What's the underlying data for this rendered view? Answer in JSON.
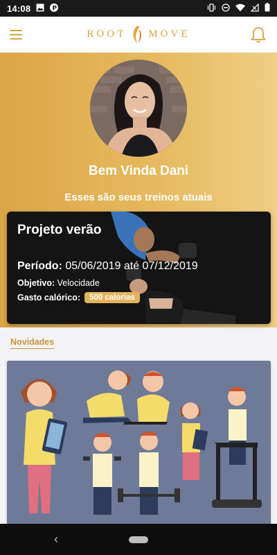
{
  "status_bar": {
    "time": "14:08",
    "left_icons": [
      "image-icon",
      "p-icon"
    ],
    "right_icons": [
      "vibrate-icon",
      "dnd-icon",
      "wifi-icon",
      "no-signal-icon",
      "battery-icon"
    ]
  },
  "app_bar": {
    "brand_left": "ROOT",
    "brand_right": "MOVE",
    "brand_icon": "leaf-icon",
    "menu_icon": "hamburger-icon",
    "notification_icon": "bell-icon",
    "accent_color": "#d9a341"
  },
  "hero": {
    "welcome": "Bem Vinda Dani",
    "subtitle": "Esses são seus treinos atuais",
    "gradient": [
      "#dba646",
      "#efcf84"
    ]
  },
  "workout": {
    "title": "Projeto verão",
    "period_label": "Período:",
    "period_value": "05/06/2019 até 07/12/2019",
    "goal_label": "Objetivo:",
    "goal_value": "Velocidade",
    "kcal_label": "Gasto calórico:",
    "kcal_value": "500 calorias"
  },
  "news": {
    "title": "Novidades",
    "card_bg": "#6e7a97"
  },
  "nav_bar": {
    "back_icon": "back-chevron-icon",
    "home_icon": "home-pill-icon"
  }
}
